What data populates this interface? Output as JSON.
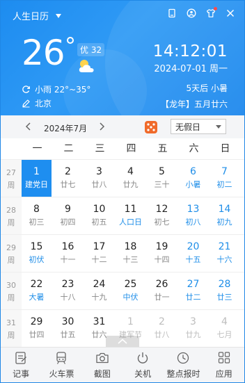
{
  "header": {
    "app_title": "人生日历",
    "temperature": "26",
    "aqi": "优 32",
    "weather_desc": "小雨 22°~35°",
    "location": "北京",
    "time": "14:12:01",
    "date_line": "2024-07-01 周一",
    "solar_term_line": "5天后 小暑",
    "lunar_line": "【龙年】五月廿六"
  },
  "nav": {
    "month_label": "2024年7月",
    "holiday_select": "无假日"
  },
  "weekdays": [
    "一",
    "二",
    "三",
    "四",
    "五",
    "六",
    "日"
  ],
  "weeks": [
    {
      "label": "27",
      "unit": "周",
      "days": [
        {
          "num": "1",
          "sub": "建党日"
        },
        {
          "num": "2",
          "sub": "廿七"
        },
        {
          "num": "3",
          "sub": "廿八"
        },
        {
          "num": "4",
          "sub": "廿九"
        },
        {
          "num": "5",
          "sub": "三十"
        },
        {
          "num": "6",
          "sub": "小暑"
        },
        {
          "num": "7",
          "sub": "初二"
        }
      ]
    },
    {
      "label": "28",
      "unit": "周",
      "days": [
        {
          "num": "8",
          "sub": "初三"
        },
        {
          "num": "9",
          "sub": "初四"
        },
        {
          "num": "10",
          "sub": "初五"
        },
        {
          "num": "11",
          "sub": "人口日"
        },
        {
          "num": "12",
          "sub": "初七"
        },
        {
          "num": "13",
          "sub": "初八"
        },
        {
          "num": "14",
          "sub": "初九"
        }
      ]
    },
    {
      "label": "29",
      "unit": "周",
      "days": [
        {
          "num": "15",
          "sub": "初伏"
        },
        {
          "num": "16",
          "sub": "十一"
        },
        {
          "num": "17",
          "sub": "十二"
        },
        {
          "num": "18",
          "sub": "十三"
        },
        {
          "num": "19",
          "sub": "十四"
        },
        {
          "num": "20",
          "sub": "十五"
        },
        {
          "num": "21",
          "sub": "十六"
        }
      ]
    },
    {
      "label": "30",
      "unit": "周",
      "days": [
        {
          "num": "22",
          "sub": "大暑"
        },
        {
          "num": "23",
          "sub": "十八"
        },
        {
          "num": "24",
          "sub": "十九"
        },
        {
          "num": "25",
          "sub": "中伏"
        },
        {
          "num": "26",
          "sub": "廿一"
        },
        {
          "num": "27",
          "sub": "廿二"
        },
        {
          "num": "28",
          "sub": "廿三"
        }
      ]
    },
    {
      "label": "31",
      "unit": "周",
      "days": [
        {
          "num": "29",
          "sub": "廿四"
        },
        {
          "num": "30",
          "sub": "廿五"
        },
        {
          "num": "31",
          "sub": "廿六"
        },
        {
          "num": "1",
          "sub": "建军节"
        },
        {
          "num": "2",
          "sub": "廿八"
        },
        {
          "num": "3",
          "sub": "廿九"
        },
        {
          "num": "4",
          "sub": "七月"
        }
      ]
    }
  ],
  "toolbar": [
    {
      "label": "记事",
      "icon": "notepad-icon"
    },
    {
      "label": "火车票",
      "icon": "train-icon"
    },
    {
      "label": "截图",
      "icon": "camera-icon"
    },
    {
      "label": "关机",
      "icon": "power-icon"
    },
    {
      "label": "整点报时",
      "icon": "clock-icon"
    },
    {
      "label": "应用",
      "icon": "apps-icon"
    }
  ],
  "colors": {
    "accent": "#1e8ef0",
    "holiday_blue": "#1f8ee8",
    "muted_grey": "#bdbdbd",
    "dice_orange": "#f06a2a"
  }
}
